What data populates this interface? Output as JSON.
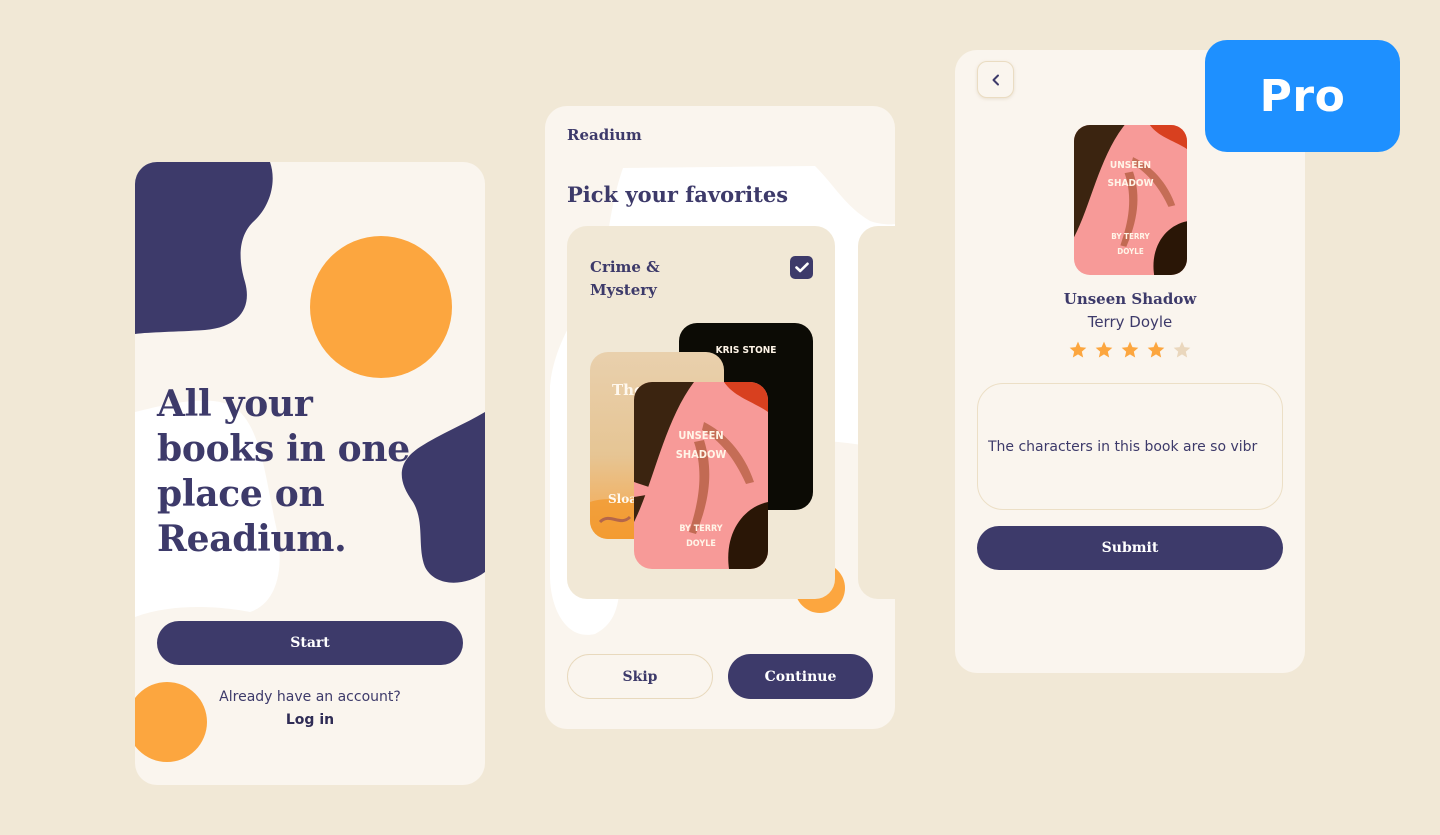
{
  "colors": {
    "background": "#f1e8d6",
    "screen": "#faf5ee",
    "primary": "#3d3a6a",
    "accent_orange": "#fca63f",
    "card": "#f1e8d6",
    "pro_blue": "#1e90ff"
  },
  "welcome_screen": {
    "headline_lines": [
      "All your",
      "books in one",
      "place on",
      "Readium."
    ],
    "start_label": "Start",
    "account_prompt": "Already have an account?",
    "login_label": "Log in"
  },
  "favorites_screen": {
    "brand": "Readium",
    "title": "Pick your favorites",
    "genres": [
      {
        "label": "Crime & Mystery",
        "checked": true,
        "books": [
          {
            "cover_author": "KRIS STONE"
          },
          {
            "cover_title": "The... In...",
            "cover_author": "Sloa..."
          },
          {
            "cover_title_lines": [
              "UNSEEN",
              "SHADOW"
            ],
            "cover_author_lines": [
              "BY TERRY",
              "DOYLE"
            ]
          }
        ]
      }
    ],
    "skip_label": "Skip",
    "continue_label": "Continue"
  },
  "review_screen": {
    "back_icon": "chevron-left-icon",
    "book": {
      "title": "Unseen Shadow",
      "author": "Terry Doyle",
      "cover_title_lines": [
        "UNSEEN",
        "SHADOW"
      ],
      "cover_author_lines": [
        "BY TERRY",
        "DOYLE"
      ],
      "rating": 4,
      "rating_max": 5
    },
    "review_text": "The characters in this book are so vibr",
    "submit_label": "Submit"
  },
  "badge": {
    "label": "Pro"
  }
}
